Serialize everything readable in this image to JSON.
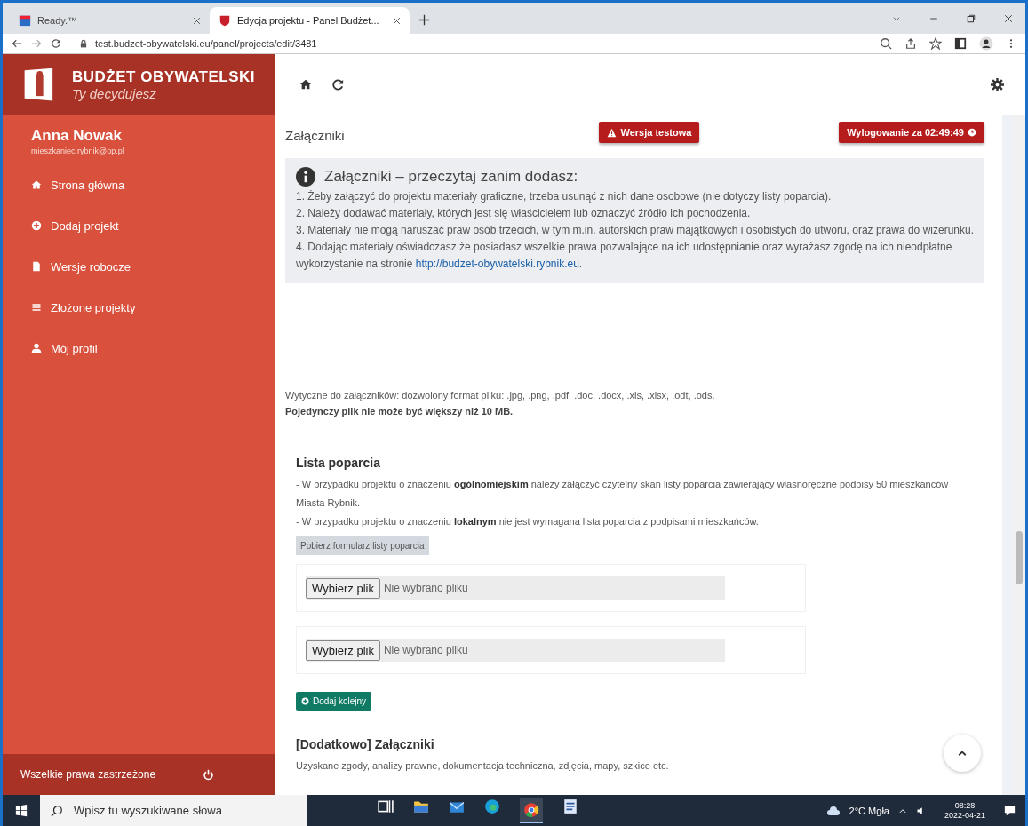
{
  "browser": {
    "tabs": [
      {
        "title": "Ready.™",
        "selected": false
      },
      {
        "title": "Edycja projektu - Panel Budżet...",
        "selected": true
      }
    ],
    "url": "test.budzet-obywatelski.eu/panel/projects/edit/3481"
  },
  "sidebar": {
    "brand": "BUDŻET OBYWATELSKI",
    "tagline": "Ty decydujesz",
    "user_name": "Anna Nowak",
    "user_email": "mieszkaniec.rybnik@op.pl",
    "items": [
      {
        "kind": "home",
        "label": "Strona główna"
      },
      {
        "kind": "plus",
        "label": "Dodaj projekt"
      },
      {
        "kind": "file",
        "label": "Wersje robocze"
      },
      {
        "kind": "list",
        "label": "Złożone projekty"
      },
      {
        "kind": "user",
        "label": "Mój profil"
      }
    ],
    "footer": "Wszelkie prawa zastrzeżone"
  },
  "badges": {
    "test_version": "Wersja testowa",
    "logout_timer": "Wylogowanie za 02:49:49"
  },
  "section_title": "Załączniki",
  "info": {
    "title": "Załączniki – przeczytaj zanim dodasz:",
    "items": [
      {
        "text": "1. Żeby załączyć do projektu materiały graficzne, trzeba usunąć z nich dane osobowe (nie dotyczy listy poparcia)."
      },
      {
        "text": "2. Należy dodawać materiały, których jest się właścicielem lub oznaczyć źródło ich pochodzenia."
      },
      {
        "text": "3. Materiały nie mogą naruszać praw osób trzecich, w tym m.in. autorskich praw majątkowych i osobistych do utworu, oraz prawa do wizerunku."
      },
      {
        "text": "4. Dodając materiały oświadczasz że posiadasz wszelkie prawa pozwalające na ich udostępnianie oraz wyrażasz zgodę na ich nieodpłatne wykorzystanie na stronie",
        "link": "http://budzet-obywatelski.rybnik.eu",
        "after": "."
      }
    ]
  },
  "guidelines": "Wytyczne do załączników: dozwolony format pliku: .jpg, .png, .pdf, .doc, .docx, .xls, .xlsx, .odt, .ods.",
  "size_limit": "Pojedynczy plik nie może być większy niż 10 MB.",
  "support_list": {
    "title": "Lista poparcia",
    "lines": [
      "- W przypadku projektu o znaczeniu **ogólnomiejskim** należy załączyć czytelny skan listy poparcia zawierający własnoręczne podpisy 50 mieszkańców Miasta Rybnik.",
      "- W przypadku projektu o znaczeniu **lokalnym** nie jest wymagana lista poparcia z podpisami mieszkańców."
    ],
    "download_button": "Pobierz formularz listy poparcia",
    "files": [
      {
        "button": "Wybierz plik",
        "status": "Nie wybrano pliku"
      },
      {
        "button": "Wybierz plik",
        "status": "Nie wybrano pliku"
      }
    ],
    "add_button": "Dodaj kolejny"
  },
  "extra": {
    "title": "[Dodatkowo] Załączniki",
    "description": "Uzyskane zgody, analizy prawne, dokumentacja techniczna, zdjęcia, mapy, szkice etc."
  },
  "taskbar": {
    "search_placeholder": "Wpisz tu wyszukiwane słowa",
    "weather": "2°C Mgła",
    "time": "08:28",
    "date": "2022-04-21"
  }
}
